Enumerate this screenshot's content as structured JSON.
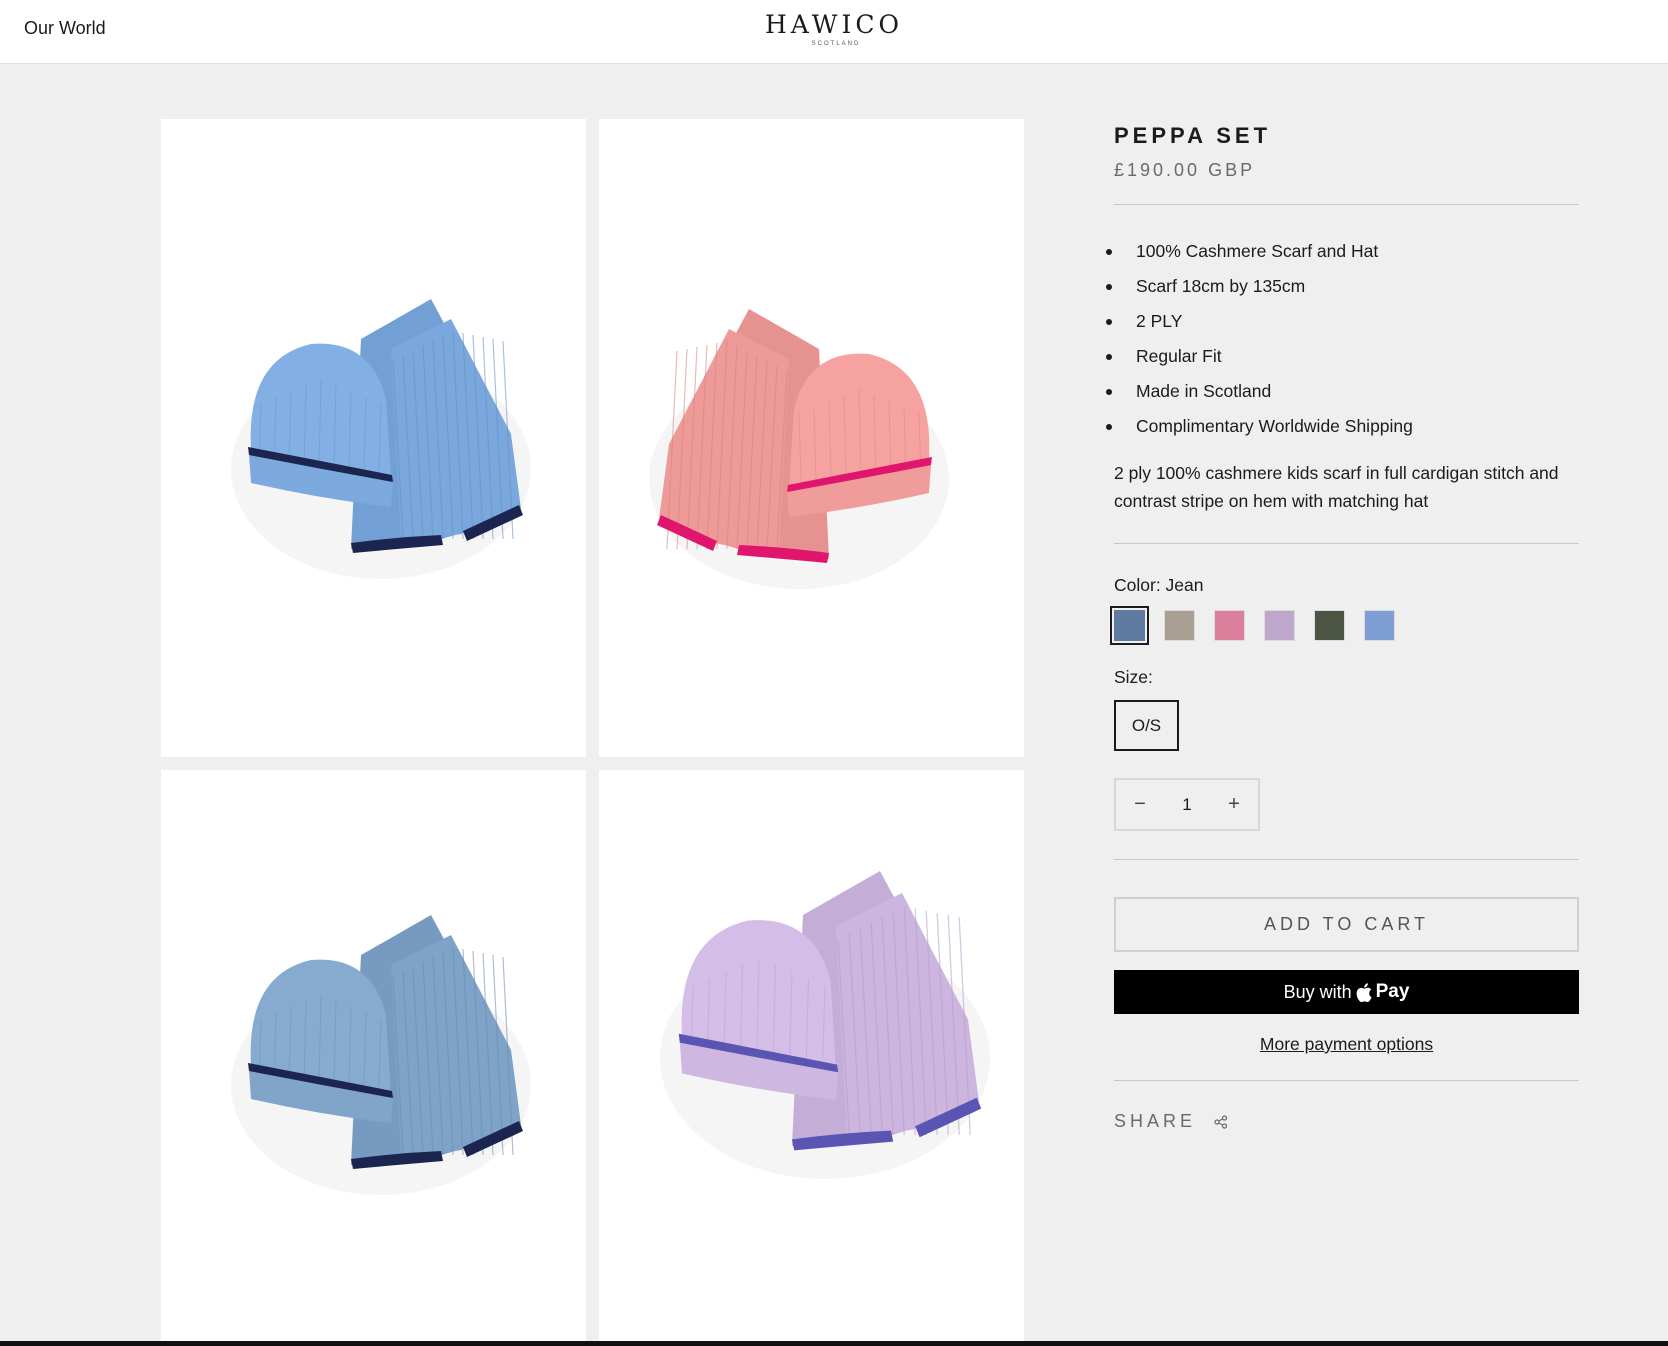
{
  "header": {
    "nav_link": "Our World",
    "logo_main": "HAWICO",
    "logo_sub": "SCOTLAND"
  },
  "gallery": [
    {
      "colorway": "sky blue with navy stripe",
      "yarn": "#7aa8dd",
      "stripe": "#1b2550"
    },
    {
      "colorway": "pink with magenta stripe",
      "yarn": "#ee9a98",
      "stripe": "#e0166e"
    },
    {
      "colorway": "jean with navy stripe",
      "yarn": "#7fa2c8",
      "stripe": "#1b2550"
    },
    {
      "colorway": "lilac with purple stripe",
      "yarn": "#ccb5df",
      "stripe": "#5a55b2"
    }
  ],
  "product": {
    "title": "PEPPA SET",
    "price": "£190.00 GBP",
    "features": [
      "100% Cashmere Scarf and Hat",
      "Scarf 18cm by 135cm",
      "2 PLY",
      "Regular Fit",
      "Made in Scotland",
      "Complimentary Worldwide Shipping"
    ],
    "description": "2 ply 100% cashmere kids scarf in full cardigan stitch and contrast stripe on hem with matching hat",
    "color_label": "Color: Jean",
    "swatches": [
      {
        "color": "#5e7aa1",
        "selected": true
      },
      {
        "color": "#a99f92",
        "selected": false
      },
      {
        "color": "#dc7f9c",
        "selected": false
      },
      {
        "color": "#bfa7cb",
        "selected": false
      },
      {
        "color": "#4c5544",
        "selected": false
      },
      {
        "color": "#7f9ed4",
        "selected": false
      }
    ],
    "size_label": "Size:",
    "size_option": "O/S",
    "quantity": {
      "minus": "−",
      "value": "1",
      "plus": "+"
    },
    "add_to_cart": "ADD TO CART",
    "buy_with": "Buy with",
    "pay_brand": "Pay",
    "more_payment": "More payment options",
    "share": "SHARE"
  },
  "icons": {
    "share": "share-icon",
    "apple": "apple-logo-icon"
  }
}
